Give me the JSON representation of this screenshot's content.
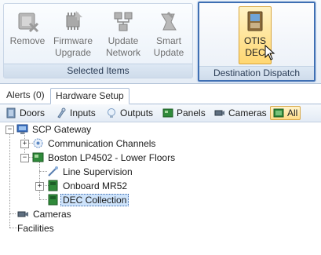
{
  "ribbon": {
    "groups": {
      "selected_items": {
        "label": "Selected Items",
        "buttons": {
          "remove": [
            "Remove"
          ],
          "firmware": [
            "Firmware",
            "Upgrade"
          ],
          "update_network": [
            "Update",
            "Network"
          ],
          "smart_update": [
            "Smart",
            "Update"
          ]
        }
      },
      "destination_dispatch": {
        "label": "Destination Dispatch",
        "buttons": {
          "otis_dec": [
            "OTIS",
            "DEC"
          ]
        }
      }
    }
  },
  "tabs": [
    {
      "label": "Alerts (0)",
      "active": false
    },
    {
      "label": "Hardware Setup",
      "active": true
    }
  ],
  "filters": [
    {
      "label": "Doors",
      "icon": "door-icon"
    },
    {
      "label": "Inputs",
      "icon": "input-icon"
    },
    {
      "label": "Outputs",
      "icon": "lightbulb-icon"
    },
    {
      "label": "Panels",
      "icon": "panel-icon"
    },
    {
      "label": "Cameras",
      "icon": "camera-icon"
    },
    {
      "label": "All",
      "icon": "all-icon",
      "active": true
    }
  ],
  "tree": {
    "root": "SCP Gateway",
    "communication_channels": "Communication Channels",
    "boston": "Boston LP4502 - Lower Floors",
    "line_supervision": "Line Supervision",
    "onboard": "Onboard MR52",
    "dec_collection": "DEC Collection",
    "cameras": "Cameras",
    "facilities": "Facilities"
  },
  "colors": {
    "focus_border": "#3f6fb3",
    "active_button": "#ffd772",
    "selection": "#cde3fb"
  }
}
